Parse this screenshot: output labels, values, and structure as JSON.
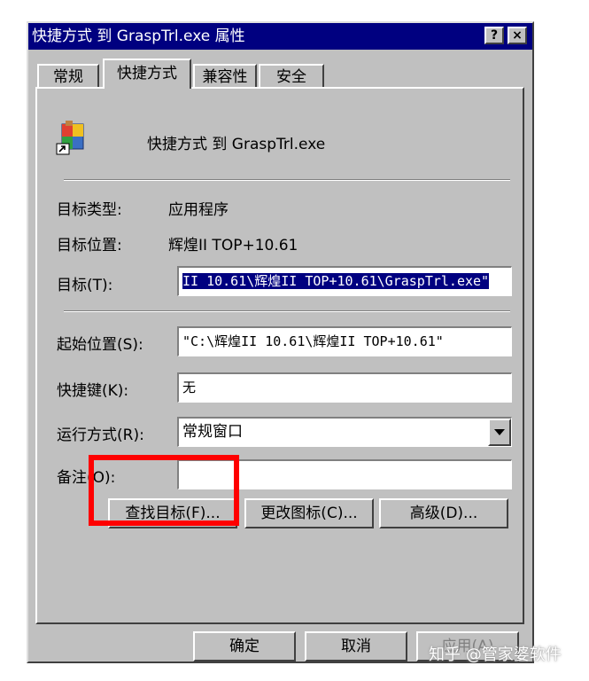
{
  "window": {
    "title": "快捷方式 到 GraspTrl.exe 属性",
    "help_label": "?",
    "close_label": "×"
  },
  "tabs": [
    {
      "label": "常规",
      "active": false
    },
    {
      "label": "快捷方式",
      "active": true
    },
    {
      "label": "兼容性",
      "active": false
    },
    {
      "label": "安全",
      "active": false
    }
  ],
  "shortcut": {
    "name": "快捷方式 到 GraspTrl.exe",
    "icon": "application-shortcut-icon"
  },
  "info": {
    "target_type_label": "目标类型:",
    "target_type_value": "应用程序",
    "target_location_label": "目标位置:",
    "target_location_value": "辉煌II TOP+10.61",
    "target_label": "目标(T):",
    "target_value": "II 10.61\\辉煌II TOP+10.61\\GraspTrl.exe\""
  },
  "fields": {
    "start_in_label": "起始位置(S):",
    "start_in_value": "\"C:\\辉煌II 10.61\\辉煌II TOP+10.61\"",
    "shortcut_key_label": "快捷键(K):",
    "shortcut_key_value": "无",
    "run_label": "运行方式(R):",
    "run_value": "常规窗口",
    "comment_label": "备注(O):",
    "comment_value": ""
  },
  "buttons": {
    "find_target": "查找目标(F)...",
    "change_icon": "更改图标(C)...",
    "advanced": "高级(D)...",
    "ok": "确定",
    "cancel": "取消",
    "apply": "应用(A)"
  },
  "watermark": "知乎 @管家婆软件",
  "colors": {
    "titlebar": "#000080",
    "face": "#c0c0c0",
    "highlight_box": "#ff0000"
  }
}
